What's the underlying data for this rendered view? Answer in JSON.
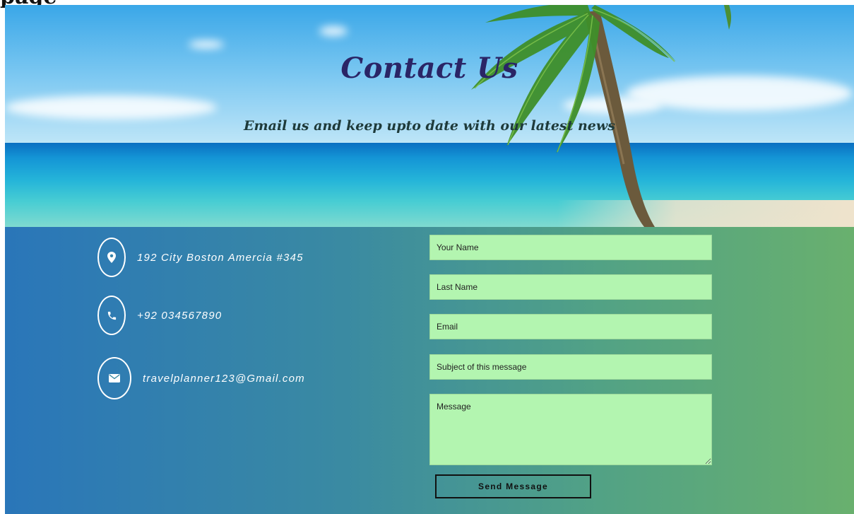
{
  "top_clip_text": "page",
  "hero": {
    "title": "Contact Us",
    "subtitle": "Email us and keep upto date with our latest news"
  },
  "contact_info": [
    {
      "icon": "map-pin-icon",
      "text": "192 City Boston Amercia #345"
    },
    {
      "icon": "phone-icon",
      "text": "+92 034567890"
    },
    {
      "icon": "envelope-icon",
      "text": "travelplanner123@Gmail.com"
    }
  ],
  "form": {
    "name_placeholder": "Your Name",
    "last_name_placeholder": "Last Name",
    "email_placeholder": "Email",
    "subject_placeholder": "Subject of this message",
    "message_placeholder": "Message",
    "submit_label": "Send Message"
  },
  "colors": {
    "title": "#2a2566",
    "field_bg": "#b3f5b0",
    "gradient_left": "#2a76b9",
    "gradient_right": "#69b06e"
  }
}
